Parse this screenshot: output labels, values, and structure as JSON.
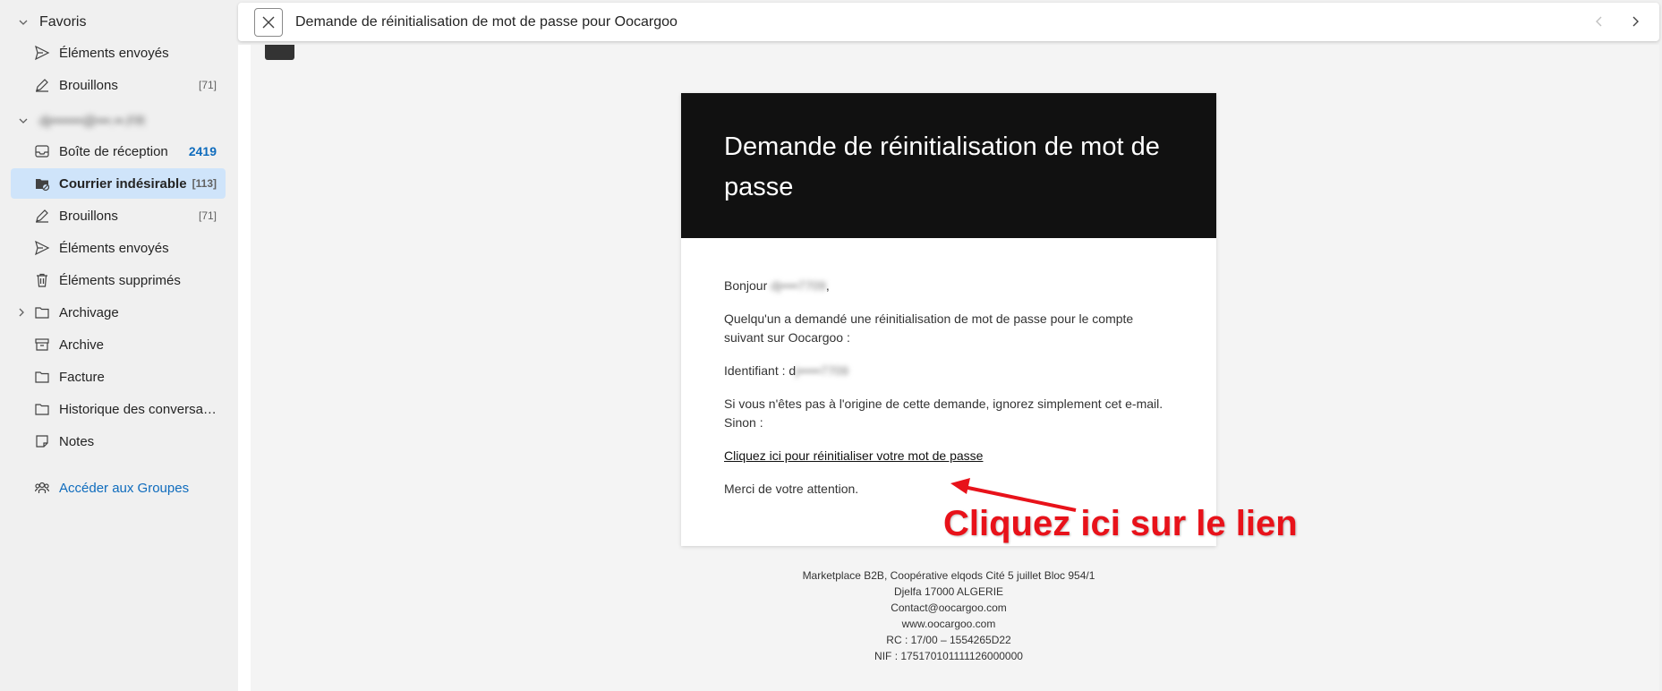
{
  "sidebar": {
    "favorites_label": "Favoris",
    "favorites": [
      {
        "label": "Éléments envoyés",
        "icon": "send-icon",
        "count": ""
      },
      {
        "label": "Brouillons",
        "icon": "draft-icon",
        "count": "[71]"
      }
    ],
    "account_label": "dj•••••••@•••.••.FR",
    "folders": [
      {
        "label": "Boîte de réception",
        "icon": "inbox-icon",
        "count": "2419"
      },
      {
        "label": "Courrier indésirable",
        "icon": "junk-folder-icon",
        "count": "[113]"
      },
      {
        "label": "Brouillons",
        "icon": "draft-icon",
        "count": "[71]"
      },
      {
        "label": "Éléments envoyés",
        "icon": "send-icon",
        "count": ""
      },
      {
        "label": "Éléments supprimés",
        "icon": "trash-icon",
        "count": ""
      },
      {
        "label": "Archivage",
        "icon": "folder-icon",
        "count": ""
      },
      {
        "label": "Archive",
        "icon": "archive-icon",
        "count": ""
      },
      {
        "label": "Facture",
        "icon": "folder-icon",
        "count": ""
      },
      {
        "label": "Historique des conversati...",
        "icon": "folder-icon",
        "count": ""
      },
      {
        "label": "Notes",
        "icon": "note-icon",
        "count": ""
      }
    ],
    "groups_link": "Accéder aux Groupes"
  },
  "header": {
    "subject": "Demande de réinitialisation de mot de passe pour Oocargoo"
  },
  "email": {
    "title": "Demande de réinitialisation de mot de passe",
    "greeting_prefix": "Bonjour",
    "greeting_name": "dj••••7709",
    "greeting_suffix": ",",
    "paragraph1": "Quelqu'un a demandé une réinitialisation de mot de passe pour le compte suivant sur Oocargoo :",
    "identifier_label": "Identifiant : d",
    "identifier_value": "j•••••7709",
    "paragraph2": "Si vous n'êtes pas à l'origine de cette demande, ignorez simplement cet e-mail. Sinon :",
    "reset_link": "Cliquez ici pour réinitialiser votre mot de passe",
    "closing": "Merci de votre attention."
  },
  "footer": {
    "lines": [
      "Marketplace B2B, Coopérative elqods Cité 5 juillet Bloc 954/1",
      "Djelfa 17000 ALGERIE",
      "Contact@oocargoo.com",
      "www.oocargoo.com",
      "RC : 17/00 – 1554265D22",
      "NIF : 175170101111126000000"
    ]
  },
  "annotation": {
    "text": "Cliquez ici sur le lien",
    "color": "#e8121a"
  },
  "colors": {
    "accent": "#0f6cbd",
    "selected_bg": "#cfe4fa"
  }
}
